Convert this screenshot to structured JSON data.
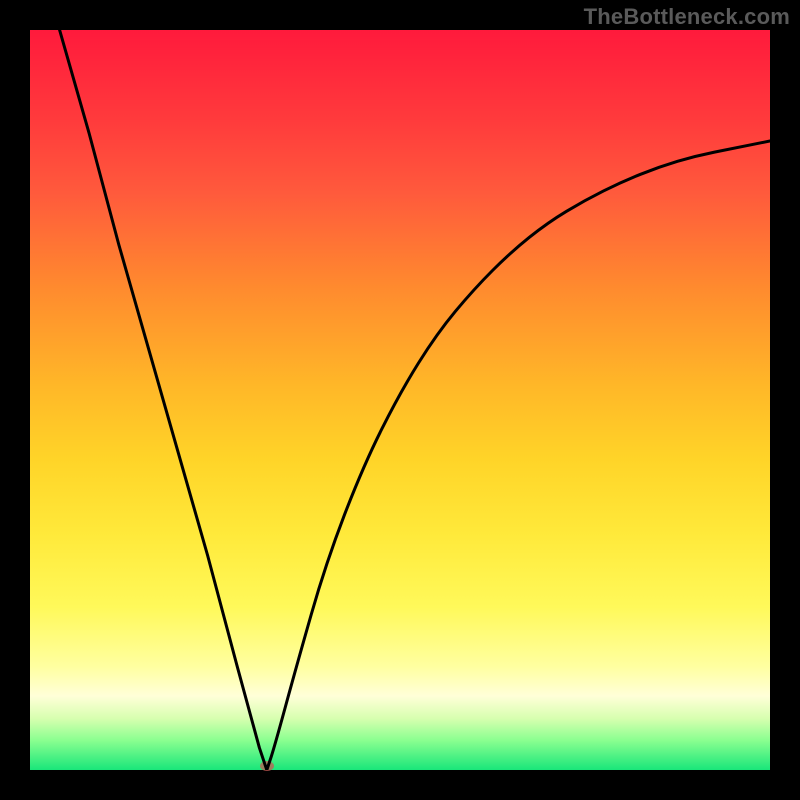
{
  "watermark": "TheBottleneck.com",
  "colors": {
    "frame_bg": "#000000",
    "curve_stroke": "#000000",
    "marker_fill": "#c65a54",
    "gradient_top": "#ff1a3c",
    "gradient_bottom": "#19e67a"
  },
  "chart_data": {
    "type": "line",
    "title": "",
    "xlabel": "",
    "ylabel": "",
    "xlim": [
      0,
      100
    ],
    "ylim": [
      0,
      100
    ],
    "grid": false,
    "description": "V-shaped bottleneck curve: steep approximately linear descent from top-left edge to a minimum near x≈32 (y≈0), then a concave rising curve approaching the upper-right asymptotically.",
    "series": [
      {
        "name": "bottleneck-curve",
        "x": [
          4,
          8,
          12,
          16,
          20,
          24,
          28,
          31,
          32,
          33,
          36,
          40,
          45,
          50,
          55,
          60,
          65,
          70,
          75,
          80,
          85,
          90,
          95,
          100
        ],
        "y": [
          100,
          86,
          71,
          57,
          43,
          29,
          14,
          3,
          0,
          3,
          14,
          28,
          41,
          51,
          59,
          65,
          70,
          74,
          77,
          79.5,
          81.5,
          83,
          84,
          85
        ]
      }
    ],
    "marker": {
      "x": 32,
      "y": 0.5
    }
  }
}
